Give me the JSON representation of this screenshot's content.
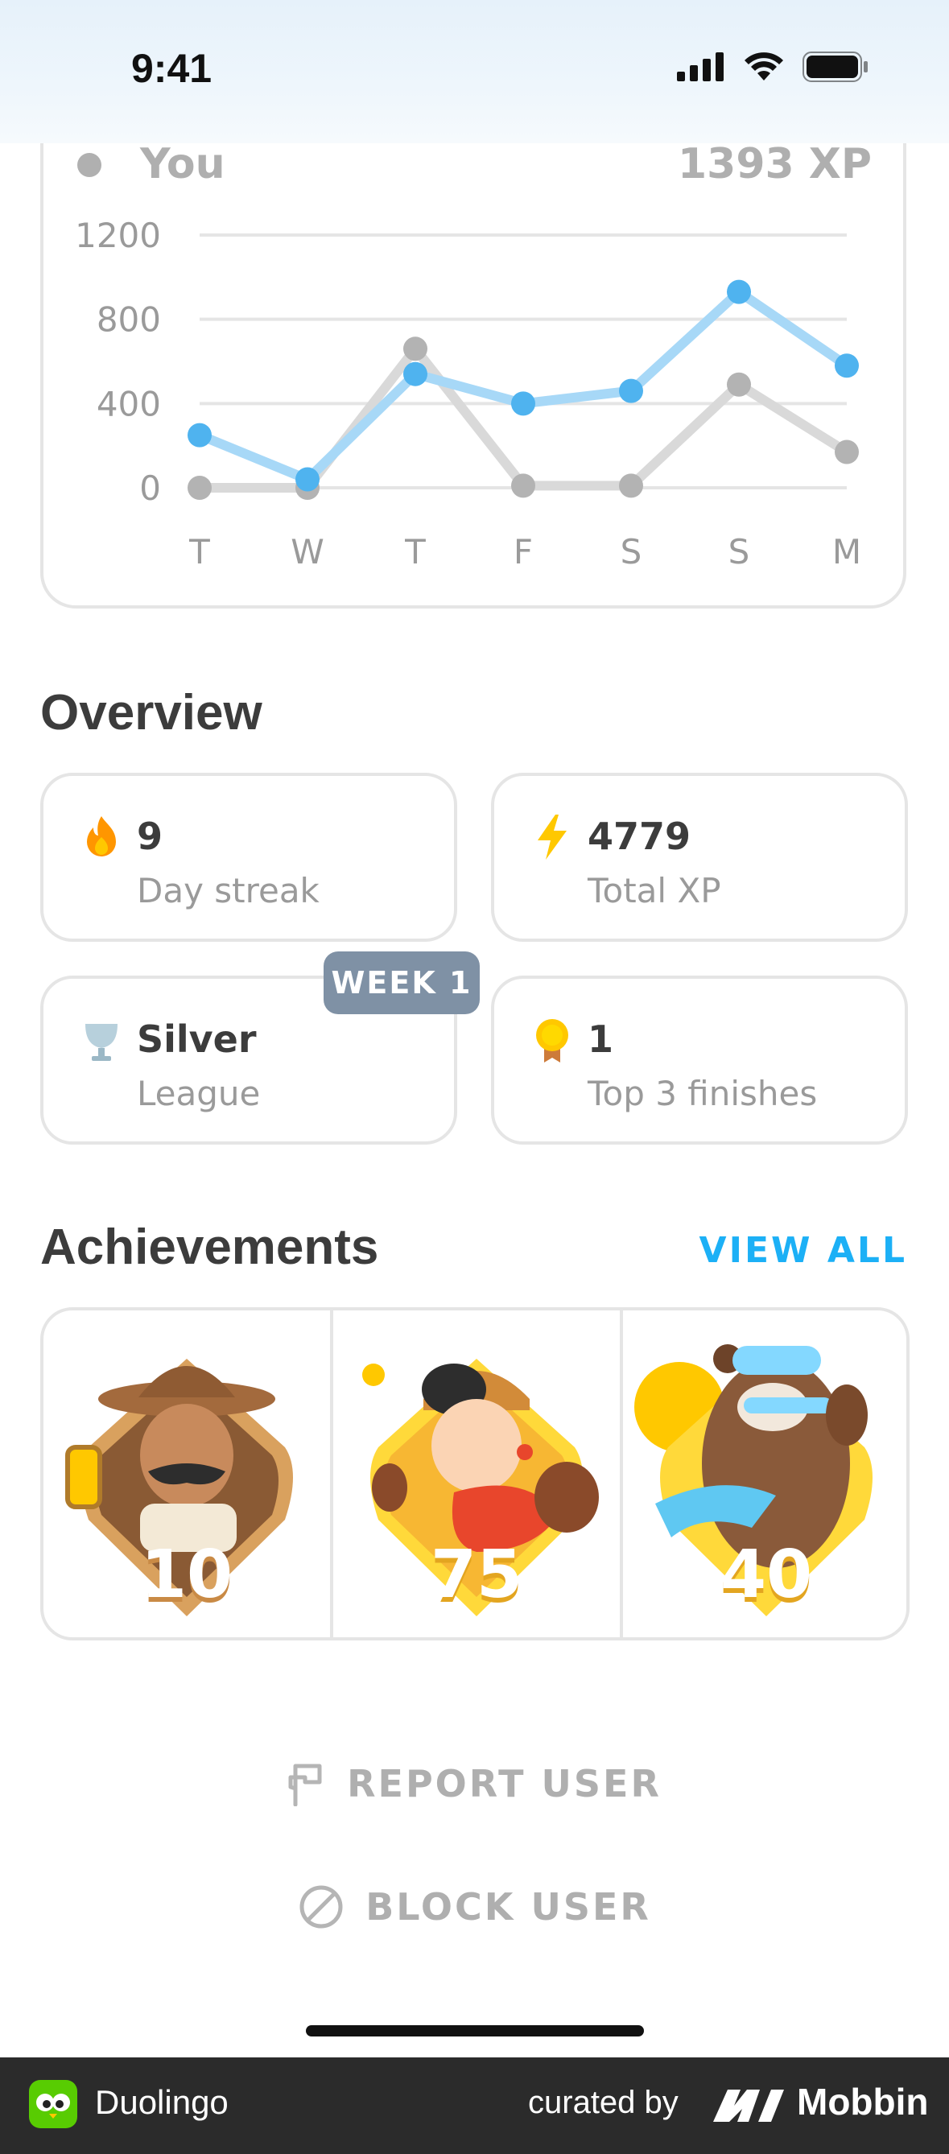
{
  "status_bar": {
    "time": "9:41"
  },
  "chart": {
    "legend_you": "You",
    "legend_xp": "1393 XP"
  },
  "chart_data": {
    "type": "line",
    "categories": [
      "T",
      "W",
      "T",
      "F",
      "S",
      "S",
      "M"
    ],
    "yticks": [
      "1200",
      "800",
      "400",
      "0"
    ],
    "ylim": [
      0,
      1200
    ],
    "grid": true,
    "series": [
      {
        "name": "You",
        "color": "#58b8f0",
        "values": [
          250,
          40,
          540,
          400,
          460,
          930,
          580
        ]
      },
      {
        "color": "#c7c7c7",
        "values": [
          0,
          0,
          660,
          10,
          10,
          490,
          170
        ]
      }
    ]
  },
  "overview": {
    "title": "Overview",
    "tiles": [
      {
        "value": "9",
        "label": "Day streak",
        "icon": "fire-icon",
        "color": "#ff9600"
      },
      {
        "value": "4779",
        "label": "Total XP",
        "icon": "lightning-icon",
        "color": "#ffc800"
      },
      {
        "value": "Silver",
        "label": "League",
        "icon": "trophy-icon",
        "color": "#b7d0dc"
      },
      {
        "value": "1",
        "label": "Top 3 finishes",
        "icon": "medal-icon",
        "color": "#ffc800"
      }
    ],
    "week_badge": "WEEK 1"
  },
  "achievements": {
    "title": "Achievements",
    "view_all": "VIEW ALL",
    "items": [
      {
        "number": "10",
        "character": "explorer"
      },
      {
        "number": "75",
        "character": "boxer"
      },
      {
        "number": "40",
        "character": "bear"
      }
    ]
  },
  "actions": {
    "report": "REPORT USER",
    "block": "BLOCK USER"
  },
  "footer": {
    "app_name": "Duolingo",
    "curated_by": "curated by",
    "brand": "Mobbin"
  }
}
